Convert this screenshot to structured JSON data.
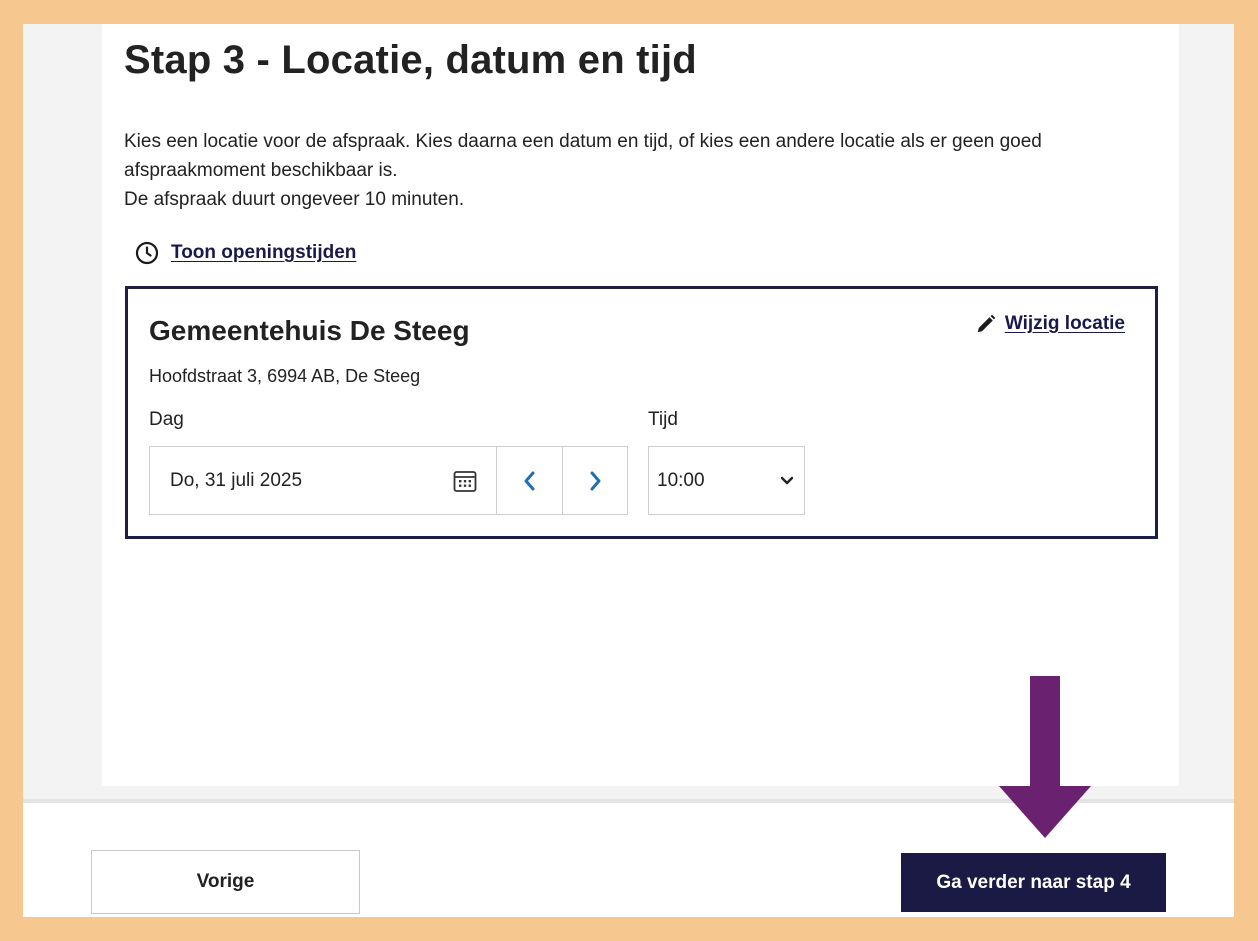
{
  "page": {
    "title": "Stap 3 - Locatie, datum en tijd",
    "intro_line1": "Kies een locatie voor de afspraak. Kies daarna een datum en tijd, of kies een andere locatie als er geen goed afspraakmoment beschikbaar is.",
    "intro_line2": "De afspraak duurt ongeveer 10 minuten.",
    "opening_hours_link": "Toon openingstijden"
  },
  "location": {
    "name": "Gemeentehuis De Steeg",
    "address": "Hoofdstraat 3, 6994 AB, De Steeg",
    "change_link": "Wijzig locatie",
    "date_label": "Dag",
    "date_value": "Do, 31 juli 2025",
    "time_label": "Tijd",
    "time_value": "10:00"
  },
  "footer": {
    "prev_label": "Vorige",
    "next_label": "Ga verder naar stap 4"
  },
  "icons": {
    "clock": "clock-icon",
    "pencil": "pencil-icon",
    "calendar": "calendar-icon",
    "prev_day": "chevron-left-icon",
    "next_day": "chevron-right-icon",
    "select": "chevron-down-icon",
    "annotation": "arrow-down-icon"
  },
  "colors": {
    "outer_frame": "#f6c78f",
    "primary": "#1a1a45",
    "link": "#1a1a4a",
    "chevron": "#1f6fb2",
    "annotation_arrow": "#6a2170"
  }
}
